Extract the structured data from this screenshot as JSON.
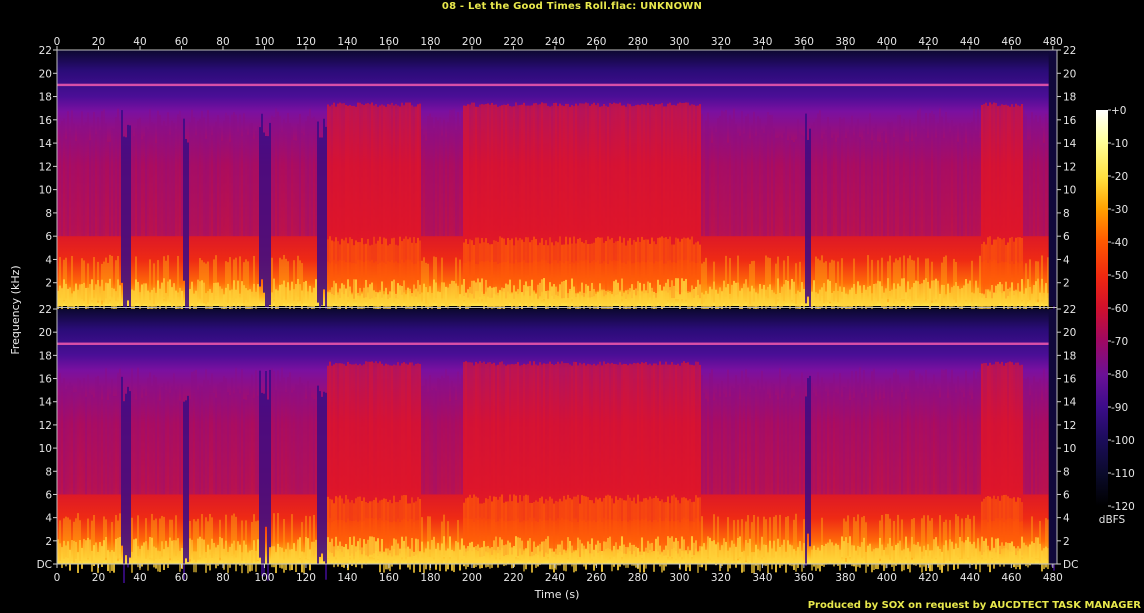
{
  "title": "08 - Let the Good Times Roll.flac: UNKNOWN",
  "credit": "Produced by SOX on request by AUCDTECT TASK MANAGER",
  "chart_data": {
    "type": "heatmap",
    "subtype": "spectrogram",
    "channels": 2,
    "xlabel": "Time (s)",
    "ylabel": "Frequency (kHz)",
    "xlim": [
      0,
      482
    ],
    "ylim": [
      0,
      22
    ],
    "x_ticks": [
      "0",
      "20",
      "40",
      "60",
      "80",
      "100",
      "120",
      "140",
      "160",
      "180",
      "200",
      "220",
      "240",
      "260",
      "280",
      "300",
      "320",
      "340",
      "360",
      "380",
      "400",
      "420",
      "440",
      "460",
      "480"
    ],
    "y_ticks": [
      "DC",
      "2",
      "4",
      "6",
      "8",
      "10",
      "12",
      "14",
      "16",
      "18",
      "20",
      "22"
    ],
    "colorbar": {
      "label": "dBFS",
      "range": [
        -120,
        0
      ],
      "ticks": [
        "+0",
        "-10",
        "-20",
        "-30",
        "-40",
        "-50",
        "-60",
        "-70",
        "-80",
        "-90",
        "-100",
        "-110",
        "-120"
      ],
      "colors": [
        "#ffffff",
        "#ffff9a",
        "#ffe040",
        "#ffa000",
        "#ff5a00",
        "#f02810",
        "#d0102c",
        "#a00860",
        "#6a1096",
        "#3c0c8a",
        "#1c0c5c",
        "#0a0a2a",
        "#000000"
      ]
    },
    "spectral_line_khz": 19,
    "cutoff_khz_approx": 17.5,
    "loud_sections_s": [
      [
        128,
        175
      ],
      [
        195,
        310
      ],
      [
        445,
        465
      ]
    ],
    "quiet_gaps_s": [
      [
        30,
        35
      ],
      [
        60,
        63
      ],
      [
        97,
        103
      ],
      [
        125,
        130
      ],
      [
        360,
        363
      ]
    ],
    "end_fade_s": 478,
    "grid": false,
    "legend": "colorbar-right"
  }
}
